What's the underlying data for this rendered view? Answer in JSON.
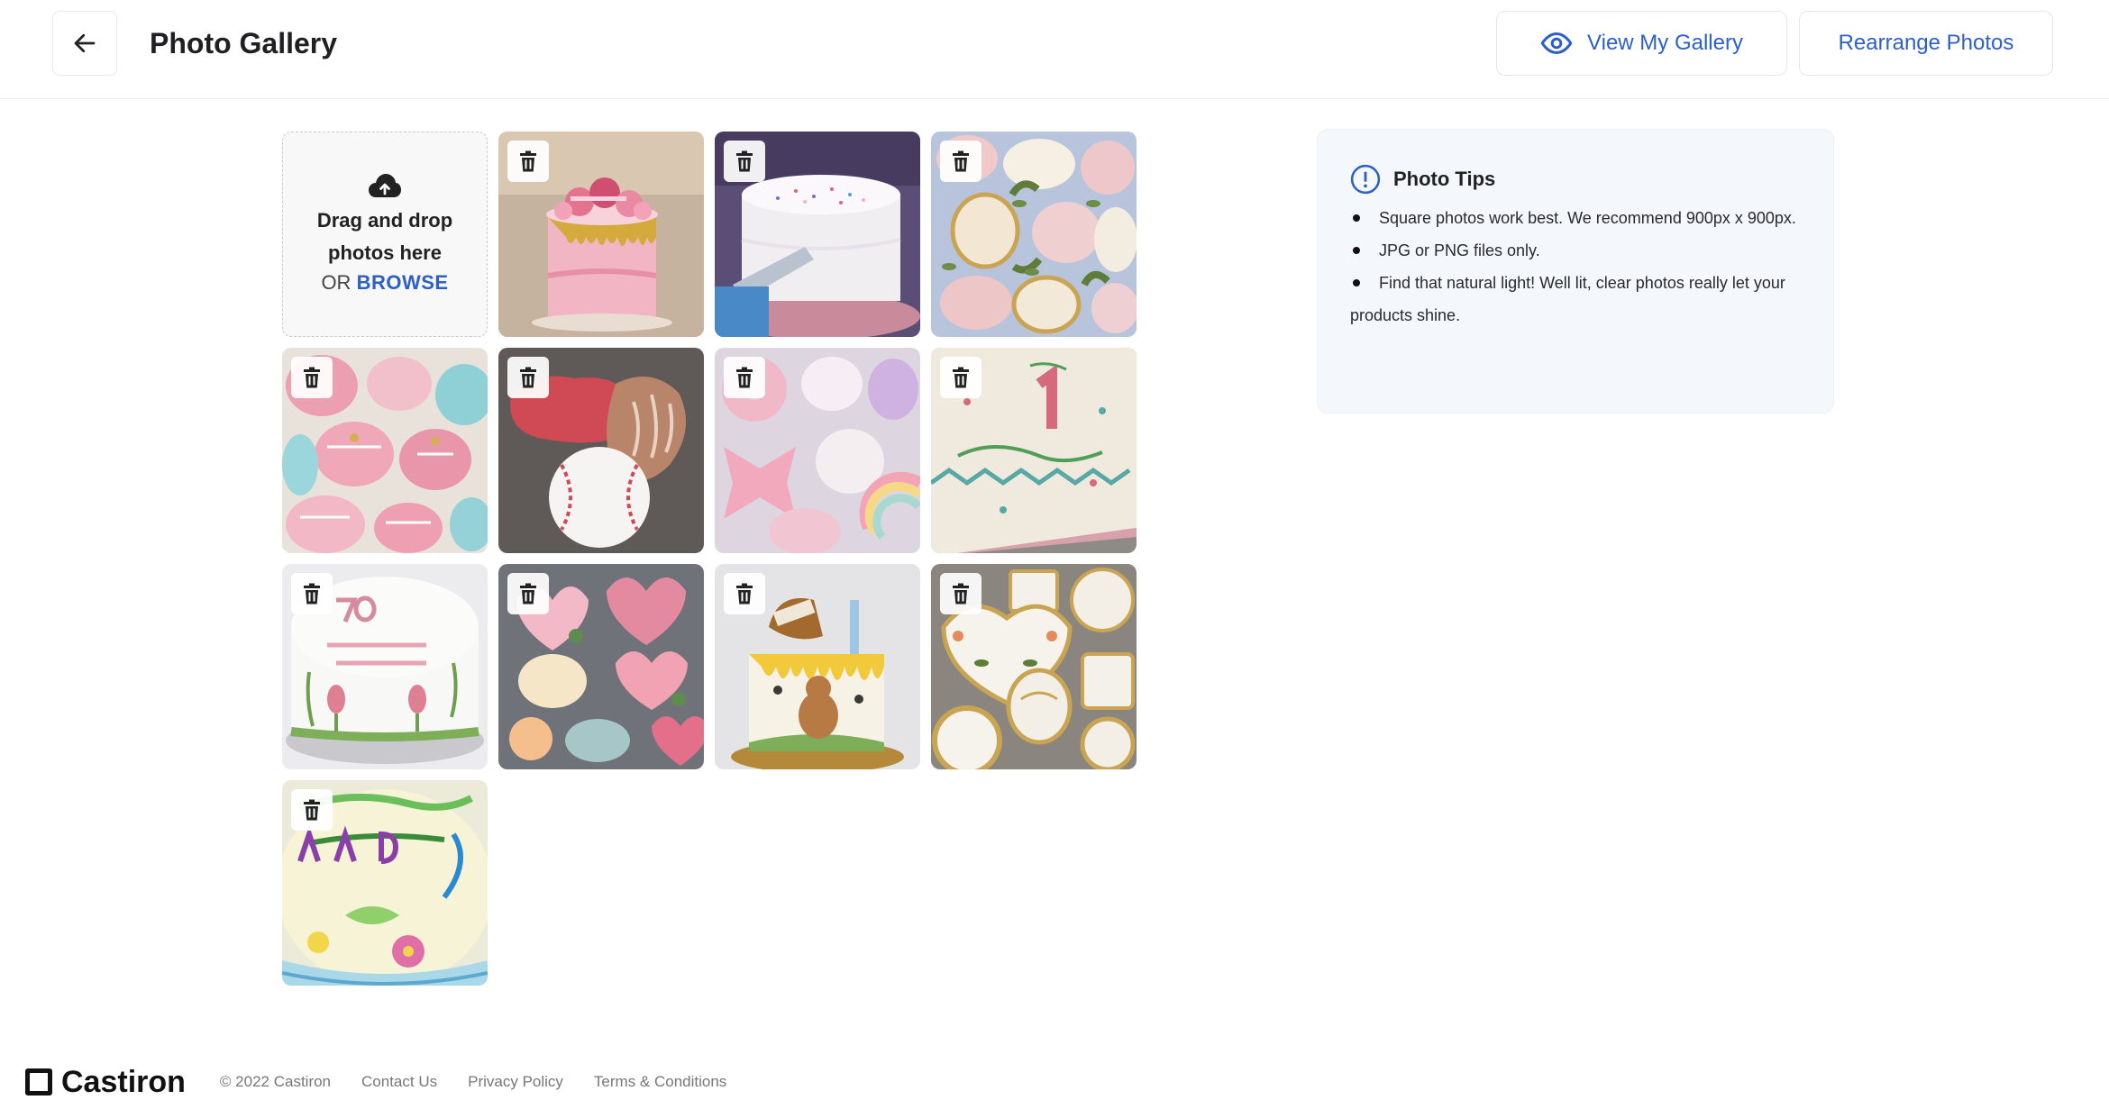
{
  "header": {
    "title": "Photo Gallery",
    "view_gallery_label": "View My Gallery",
    "rearrange_label": "Rearrange Photos"
  },
  "upload": {
    "text": "Drag and drop photos here",
    "or_label": "OR",
    "browse_label": "BROWSE"
  },
  "photos": [
    {
      "subject": "pink drip cake with macarons"
    },
    {
      "subject": "white sprinkle cake being frosted"
    },
    {
      "subject": "floral wedding cookies"
    },
    {
      "subject": "pink and teal teapot cookies"
    },
    {
      "subject": "baseball cookies"
    },
    {
      "subject": "pastel unicorn cookies"
    },
    {
      "subject": "happy 1st birthday sheet cake"
    },
    {
      "subject": "70 years loved cake"
    },
    {
      "subject": "heart and bouquet cookies"
    },
    {
      "subject": "honey pot bear cake"
    },
    {
      "subject": "she said yes cookies"
    },
    {
      "subject": "happy birthday floral cake"
    }
  ],
  "tips": {
    "title": "Photo Tips",
    "items": [
      "Square photos work best. We recommend 900px x 900px.",
      "JPG or PNG files only.",
      "Find that natural light! Well lit, clear photos really let your products shine."
    ]
  },
  "footer": {
    "brand": "Castiron",
    "copyright": "© 2022 Castiron",
    "links": [
      "Contact Us",
      "Privacy Policy",
      "Terms & Conditions"
    ]
  },
  "colors": {
    "accent": "#2c5fc9",
    "tips_bg": "#f4f7fc"
  }
}
